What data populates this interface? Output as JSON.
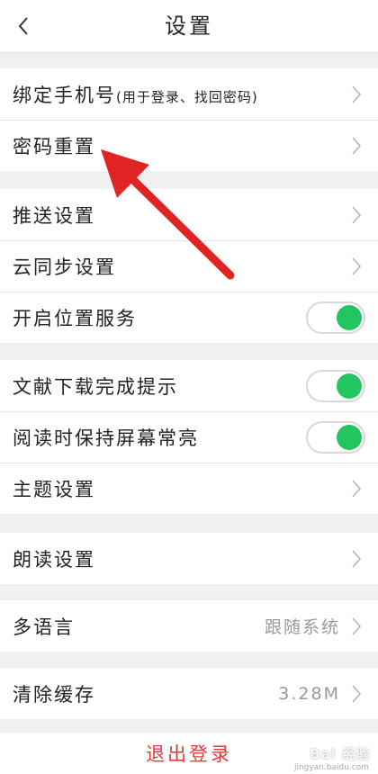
{
  "header": {
    "title": "设置",
    "back_icon": "chevron-left-icon"
  },
  "groups": [
    {
      "items": [
        {
          "id": "bind-phone",
          "label": "绑定手机号",
          "hint": "(用于登录、找回密码)",
          "control": "chevron"
        },
        {
          "id": "password-reset",
          "label": "密码重置",
          "control": "chevron"
        }
      ]
    },
    {
      "items": [
        {
          "id": "push-settings",
          "label": "推送设置",
          "control": "chevron"
        },
        {
          "id": "cloud-sync",
          "label": "云同步设置",
          "control": "chevron"
        },
        {
          "id": "location-service",
          "label": "开启位置服务",
          "control": "toggle",
          "on": true
        }
      ]
    },
    {
      "items": [
        {
          "id": "download-notify",
          "label": "文献下载完成提示",
          "control": "toggle",
          "on": true
        },
        {
          "id": "screen-awake",
          "label": "阅读时保持屏幕常亮",
          "control": "toggle",
          "on": true
        },
        {
          "id": "theme",
          "label": "主题设置",
          "control": "chevron"
        }
      ]
    },
    {
      "items": [
        {
          "id": "read-aloud",
          "label": "朗读设置",
          "control": "chevron"
        }
      ]
    },
    {
      "items": [
        {
          "id": "language",
          "label": "多语言",
          "value": "跟随系统",
          "control": "chevron"
        }
      ]
    },
    {
      "items": [
        {
          "id": "clear-cache",
          "label": "清除缓存",
          "value": "3.28M",
          "control": "chevron"
        }
      ]
    }
  ],
  "logout": {
    "label": "退出登录"
  },
  "colors": {
    "toggle_on": "#22c55e",
    "logout_text": "#e33b3b",
    "annotation_arrow": "#e02424"
  },
  "watermark": {
    "text": "Bai 经验",
    "sub": "jingyan.baidu.com"
  }
}
